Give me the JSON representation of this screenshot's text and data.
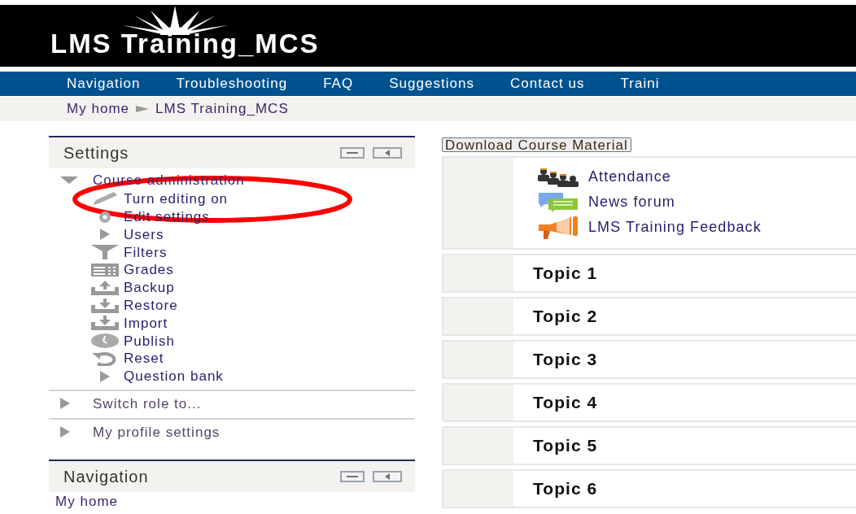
{
  "header": {
    "site_title": "LMS Training_MCS"
  },
  "nav_menu": [
    "Navigation",
    "Troubleshooting",
    "FAQ",
    "Suggestions",
    "Contact us",
    "Traini"
  ],
  "breadcrumb": [
    "My home",
    "LMS Training_MCS"
  ],
  "settings_block": {
    "title": "Settings",
    "tree": [
      {
        "label": "Course administration",
        "expanded": true,
        "children": [
          {
            "label": "Turn editing on"
          },
          {
            "label": "Edit settings"
          },
          {
            "label": "Users"
          },
          {
            "label": "Filters"
          },
          {
            "label": "Grades"
          },
          {
            "label": "Backup"
          },
          {
            "label": "Restore"
          },
          {
            "label": "Import"
          },
          {
            "label": "Publish"
          },
          {
            "label": "Reset"
          },
          {
            "label": "Question bank"
          }
        ]
      },
      {
        "label": "Switch role to...",
        "expanded": false
      },
      {
        "label": "My profile settings",
        "expanded": false
      }
    ]
  },
  "navigation_block": {
    "title": "Navigation",
    "items": [
      "My home"
    ]
  },
  "annotation": {
    "kind": "ellipse"
  },
  "download_button": "Download Course Material",
  "activities": [
    "Attendance",
    "News forum",
    "LMS Training Feedback"
  ],
  "topics": [
    "Topic 1",
    "Topic 2",
    "Topic 3",
    "Topic 4",
    "Topic 5",
    "Topic 6"
  ]
}
